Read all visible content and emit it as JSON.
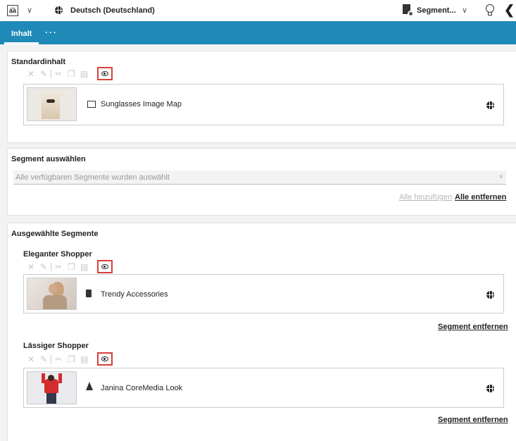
{
  "topbar": {
    "locale_icon_text": "a͡a",
    "locale_label": "Deutsch (Deutschland)",
    "segment_label": "Segment...",
    "chevron": "∨",
    "back_glyph": "❮"
  },
  "tabs": {
    "active": "Inhalt",
    "more": "···"
  },
  "default_content": {
    "title": "Standardinhalt",
    "item": {
      "label": "Sunglasses Image Map",
      "type_icon": "image-map-icon"
    }
  },
  "segment_select": {
    "title": "Segment auswählen",
    "placeholder": "Alle verfügbaren Segmente wurden auswählt",
    "add_all": "Alle hinzufügen",
    "remove_all": "Alle entfernen"
  },
  "selected_segments": {
    "title": "Ausgewählte Segmente",
    "segments": [
      {
        "name": "Eleganter Shopper",
        "item_label": "Trendy Accessories",
        "type_icon": "collection-icon",
        "remove_label": "Segment entfernen"
      },
      {
        "name": "Lässiger Shopper",
        "item_label": "Janina CoreMedia Look",
        "type_icon": "shopping-look-icon",
        "remove_label": "Segment entfernen"
      }
    ]
  },
  "toolbar_icons": {
    "remove": "✕",
    "edit": "✎",
    "cut": "✂",
    "copy": "❐",
    "paste": "▤"
  },
  "colors": {
    "tabbar": "#1f8ab8",
    "highlight": "#d7403a"
  }
}
